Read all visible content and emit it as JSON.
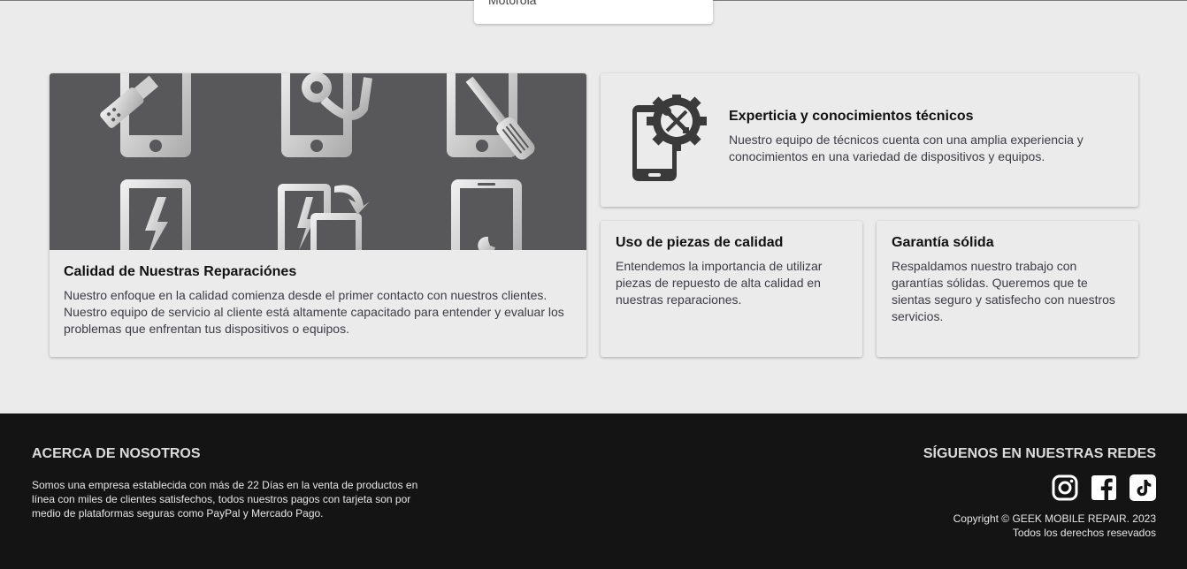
{
  "dropdown": {
    "last_item": "Motorola"
  },
  "cards": {
    "main": {
      "title": "Calidad de Nuestras Reparaciónes",
      "text": "Nuestro enfoque en la calidad comienza desde el primer contacto con nuestros clientes. Nuestro equipo de servicio al cliente está altamente capacitado para entender y evaluar los problemas que enfrentan tus dispositivos o equipos."
    },
    "expertise": {
      "title": "Experticia y conocimientos técnicos",
      "text": "Nuestro equipo de técnicos cuenta con una amplia experiencia y conocimientos en una variedad de dispositivos y equipos."
    },
    "parts": {
      "title": "Uso de piezas de calidad",
      "text": "Entendemos la importancia de utilizar piezas de repuesto de alta calidad en nuestras reparaciones."
    },
    "warranty": {
      "title": "Garantía sólida",
      "text": "Respaldamos nuestro trabajo con garantías sólidas. Queremos que te sientas seguro y satisfecho con nuestros servicios."
    }
  },
  "footer": {
    "about_title": "ACERCA DE NOSOTROS",
    "about_text": "Somos una empresa establecida con más de 22 Días en la venta de productos en línea con miles de clientes satisfechos, todos nuestros pagos con tarjeta son por medio de plataformas seguras como PayPal y Mercado Pago.",
    "social_title": "SÍGUENOS EN NUESTRAS REDES",
    "social_icons": [
      "instagram-icon",
      "facebook-icon",
      "tiktok-icon"
    ],
    "copyright": "Copyright © GEEK MOBILE REPAIR. 2023",
    "rights": "Todos los derechos resevados"
  },
  "colors": {
    "page_bg": "#ebebeb",
    "banner_bg": "#58585a",
    "footer_bg": "#141414"
  }
}
